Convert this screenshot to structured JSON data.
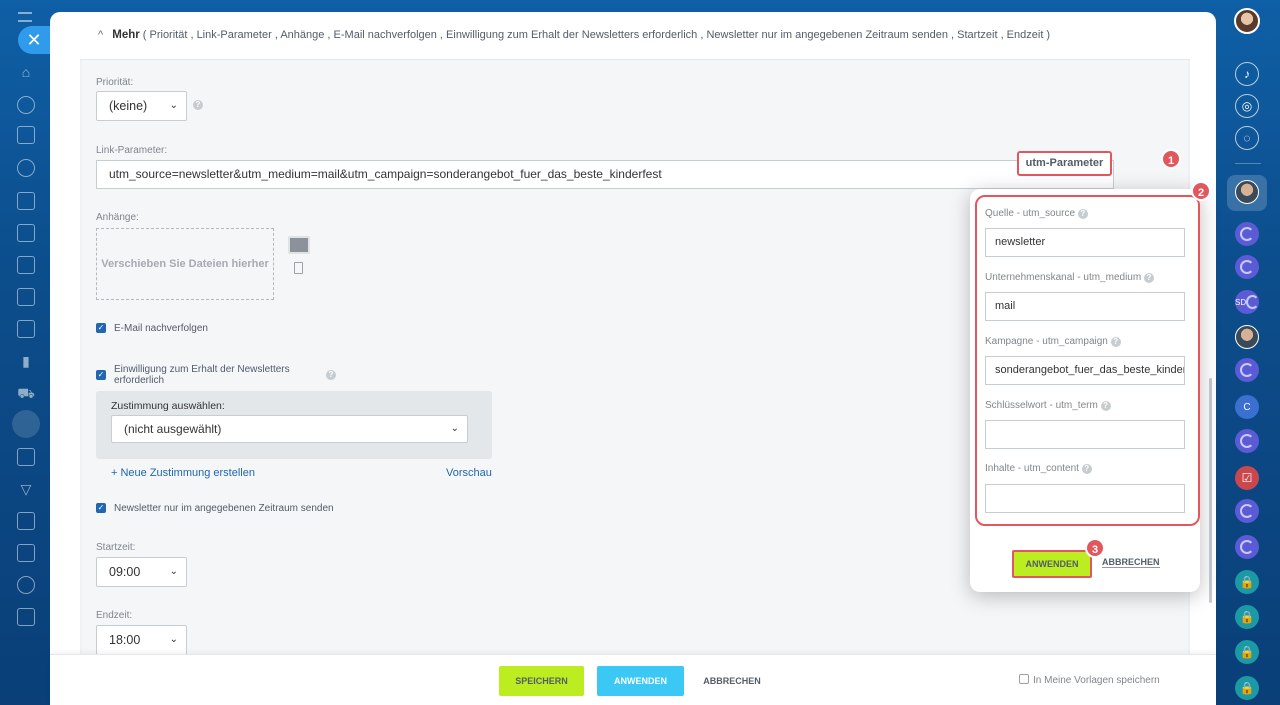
{
  "more": {
    "chevron": "^",
    "title": "Mehr",
    "summary": "( Priorität ,  Link-Parameter ,  Anhänge ,  E-Mail nachverfolgen ,  Einwilligung zum Erhalt der Newsletters erforderlich ,  Newsletter nur im angegebenen Zeitraum senden ,  Startzeit ,  Endzeit  )"
  },
  "priority": {
    "label": "Priorität:",
    "value": "(keine)"
  },
  "link_params": {
    "label": "Link-Parameter:",
    "value": "utm_source=newsletter&utm_medium=mail&utm_campaign=sonderangebot_fuer_das_beste_kinderfest",
    "utm_button": "utm-Parameter"
  },
  "attachments": {
    "label": "Anhänge:",
    "dropzone": "Verschieben Sie Dateien hierher"
  },
  "track_email": {
    "label": "E-Mail nachverfolgen",
    "checked": true
  },
  "consent": {
    "label_line1": "Einwilligung zum Erhalt der Newsletters",
    "label_line2": "erforderlich",
    "checked": true,
    "select_label": "Zustimmung auswählen:",
    "select_value": "(nicht ausgewählt)",
    "create_link": "+ Neue Zustimmung erstellen",
    "preview_link": "Vorschau"
  },
  "period": {
    "label": "Newsletter nur im angegebenen Zeitraum senden",
    "checked": true
  },
  "start": {
    "label": "Startzeit:",
    "value": "09:00"
  },
  "end": {
    "label": "Endzeit:",
    "value": "18:00"
  },
  "utm_popup": {
    "source_label": "Quelle - utm_source",
    "source_value": "newsletter",
    "medium_label": "Unternehmenskanal - utm_medium",
    "medium_value": "mail",
    "campaign_label": "Kampagne - utm_campaign",
    "campaign_value": "sonderangebot_fuer_das_beste_kinderfest",
    "term_label": "Schlüsselwort - utm_term",
    "term_value": "",
    "content_label": "Inhalte - utm_content",
    "content_value": "",
    "apply": "ANWENDEN",
    "cancel": "ABBRECHEN"
  },
  "badges": {
    "one": "1",
    "two": "2",
    "three": "3"
  },
  "footer": {
    "save": "SPEICHERN",
    "apply": "ANWENDEN",
    "cancel": "ABBRECHEN",
    "template": "In Meine Vorlagen speichern"
  },
  "sidebar_right": {
    "sd": "SD",
    "c": "C"
  },
  "colors": {
    "accent": "#2067b0",
    "green": "#bbed21",
    "blue": "#3bc8f5",
    "highlight": "#e2575e"
  }
}
